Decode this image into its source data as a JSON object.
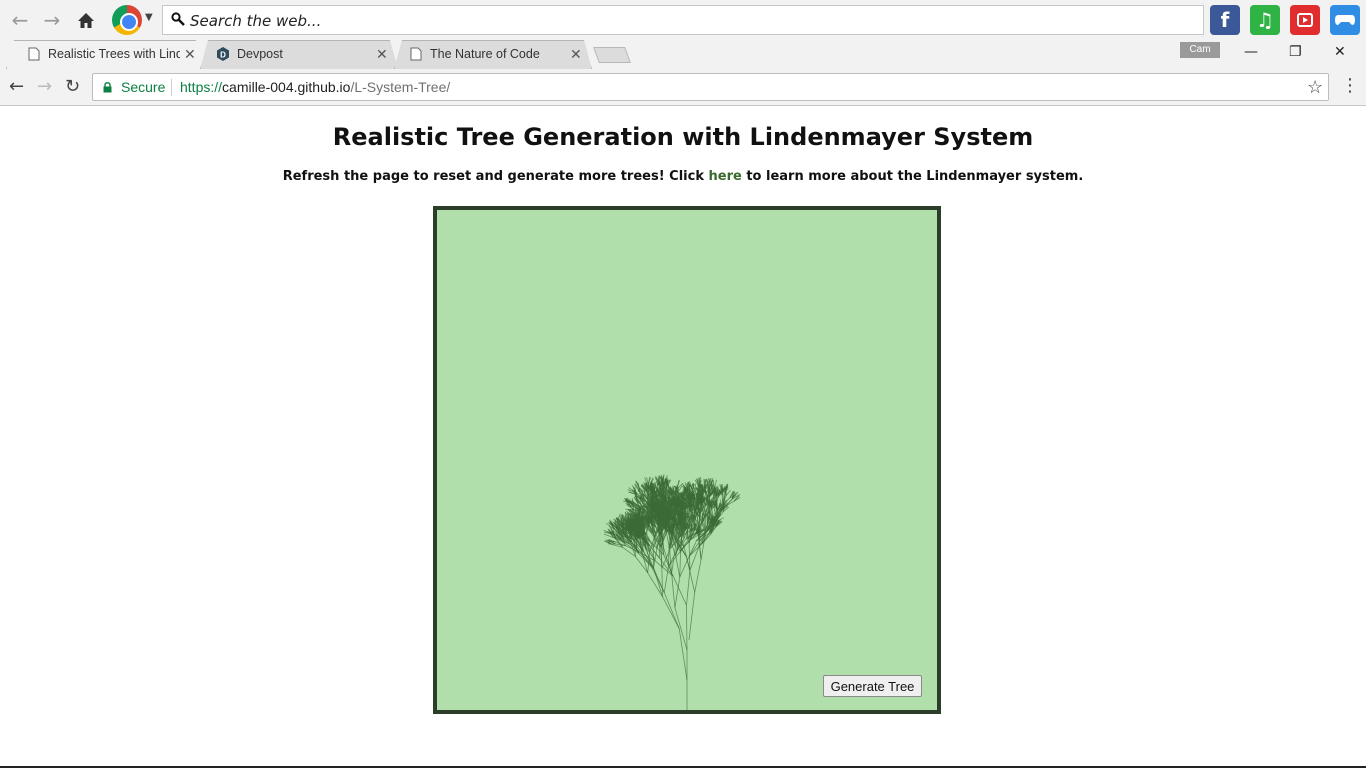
{
  "toolbar": {
    "search_placeholder": "Search the web...",
    "apps": [
      "facebook-icon",
      "music-icon",
      "youtube-icon",
      "games-icon"
    ]
  },
  "tabs": [
    {
      "label": "Realistic Trees with Linde",
      "active": true,
      "icon": "page-icon"
    },
    {
      "label": "Devpost",
      "active": false,
      "icon": "devpost-icon"
    },
    {
      "label": "The Nature of Code",
      "active": false,
      "icon": "page-icon"
    }
  ],
  "profile_badge": "Cam",
  "address": {
    "secure_label": "Secure",
    "url_scheme": "https://",
    "url_host": "camille-004.github.io",
    "url_path": "/L-System-Tree/"
  },
  "page": {
    "title": "Realistic Tree Generation with Lindenmayer System",
    "subtitle_before": "Refresh the page to reset and generate more trees! Click ",
    "subtitle_link": "here",
    "subtitle_after": " to learn more about the Lindenmayer system.",
    "button_label": "Generate Tree"
  },
  "colors": {
    "canvas_bg": "#b1dfac",
    "canvas_border": "#2c3e2a",
    "tree": "#3d6b37",
    "secure_green": "#0b8043"
  }
}
